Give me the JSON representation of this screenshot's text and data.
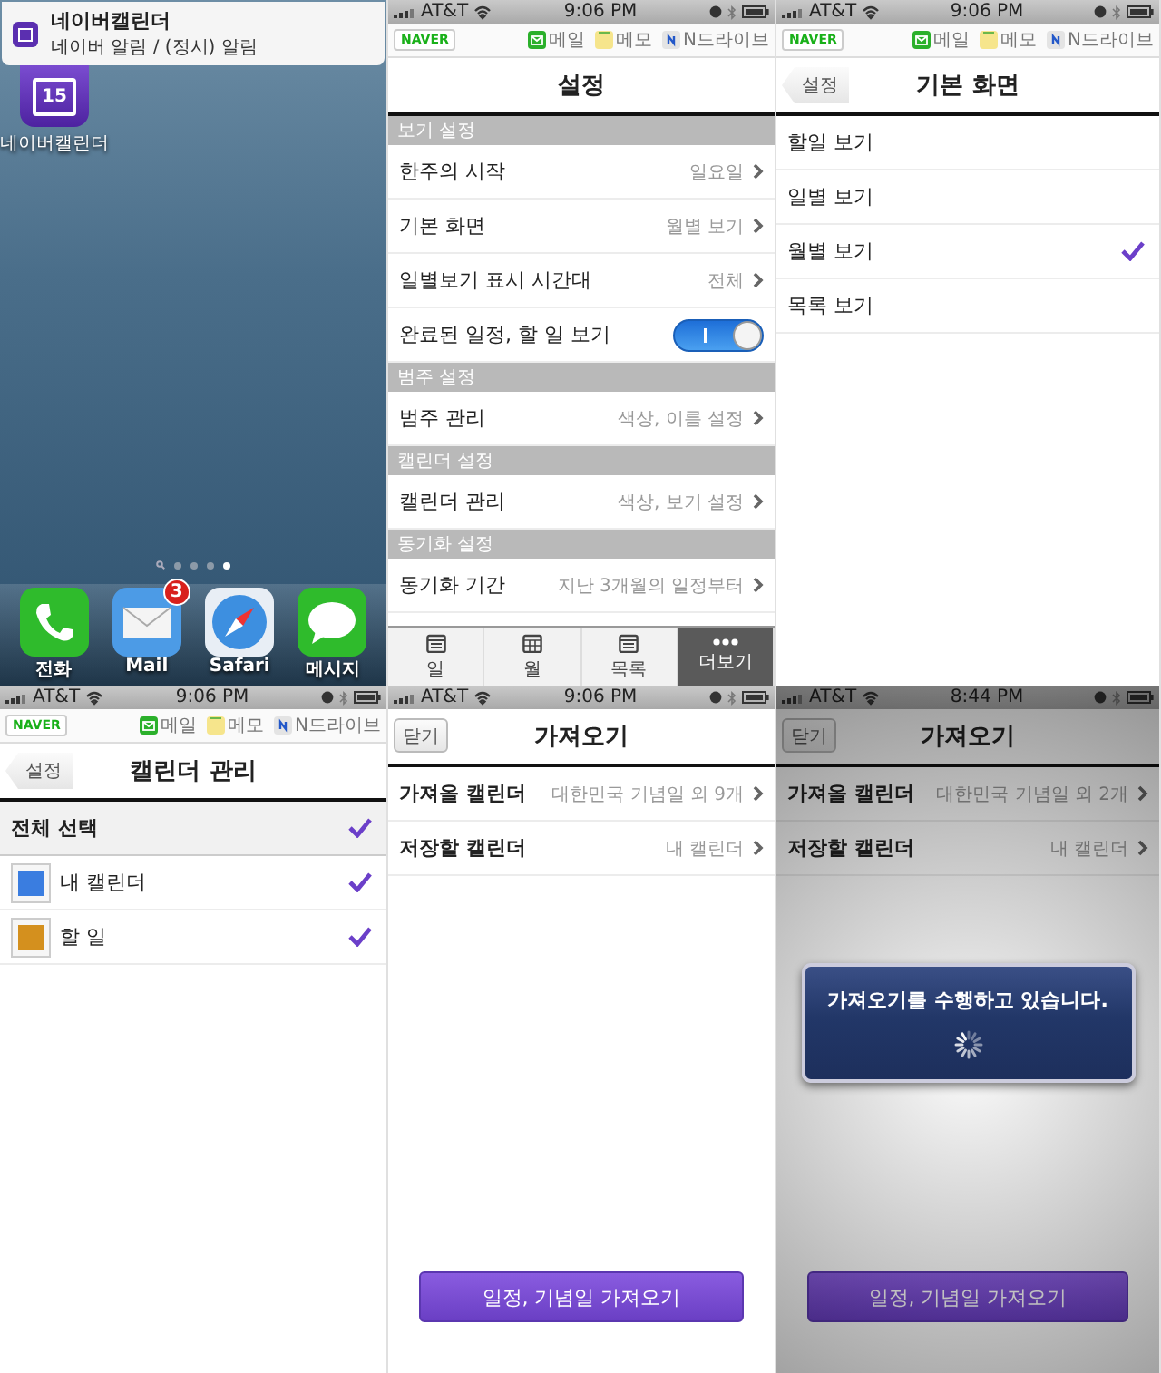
{
  "home_screen": {
    "notification": {
      "title": "네이버캘린더",
      "message": "네이버 알림 / (정시) 알림"
    },
    "app_icon": {
      "date": "15",
      "label": "네이버캘린더"
    },
    "page_dots": [
      {
        "selected": false
      },
      {
        "selected": false
      },
      {
        "selected": false
      },
      {
        "selected": true
      }
    ],
    "dock": [
      {
        "kind": "phone",
        "label": "전화"
      },
      {
        "kind": "mail",
        "label": "Mail",
        "badge": "3"
      },
      {
        "kind": "browser",
        "label": "Safari"
      },
      {
        "kind": "messages",
        "label": "메시지"
      }
    ]
  },
  "settings_screen": {
    "status_bar": {
      "carrier": "AT&T",
      "time": "9:06 PM"
    },
    "naver_bar": {
      "logo": "NAVER",
      "links": [
        {
          "kind": "mail",
          "label": "메일"
        },
        {
          "kind": "memo",
          "label": "메모"
        },
        {
          "kind": "drive",
          "label": "N드라이브"
        }
      ]
    },
    "title": "설정",
    "sections": [
      {
        "header": "보기 설정",
        "rows": [
          {
            "kind": "link",
            "label": "한주의 시작",
            "value": "일요일"
          },
          {
            "kind": "link",
            "label": "기본 화면",
            "value": "월별 보기"
          },
          {
            "kind": "link",
            "label": "일별보기 표시 시간대",
            "value": "전체"
          },
          {
            "kind": "toggle",
            "label": "완료된 일정, 할 일 보기",
            "on": true
          }
        ]
      },
      {
        "header": "범주 설정",
        "rows": [
          {
            "kind": "link",
            "label": "범주 관리",
            "value": "색상, 이름 설정"
          }
        ]
      },
      {
        "header": "캘린더 설정",
        "rows": [
          {
            "kind": "link",
            "label": "캘린더 관리",
            "value": "색상, 보기 설정"
          }
        ]
      },
      {
        "header": "동기화 설정",
        "rows": [
          {
            "kind": "link",
            "label": "동기화 기간",
            "value": "지난 3개월의 일정부터"
          }
        ]
      }
    ],
    "tab_bar": [
      {
        "kind": "day",
        "label": "일",
        "selected": false
      },
      {
        "kind": "month",
        "label": "월",
        "selected": false
      },
      {
        "kind": "list",
        "label": "목록",
        "selected": false
      },
      {
        "kind": "more",
        "label": "더보기",
        "selected": true
      }
    ]
  },
  "default_view_screen": {
    "status_bar": {
      "carrier": "AT&T",
      "time": "9:06 PM"
    },
    "naver_bar": {
      "logo": "NAVER",
      "links": [
        {
          "kind": "mail",
          "label": "메일"
        },
        {
          "kind": "memo",
          "label": "메모"
        },
        {
          "kind": "drive",
          "label": "N드라이브"
        }
      ]
    },
    "back_button": "설정",
    "title": "기본 화면",
    "options": [
      {
        "label": "할일 보기",
        "selected": false
      },
      {
        "label": "일별 보기",
        "selected": false
      },
      {
        "label": "월별 보기",
        "selected": true
      },
      {
        "label": "목록 보기",
        "selected": false
      }
    ]
  },
  "calendar_manage_screen": {
    "status_bar": {
      "carrier": "AT&T",
      "time": "9:06 PM"
    },
    "naver_bar": {
      "logo": "NAVER",
      "links": [
        {
          "kind": "mail",
          "label": "메일"
        },
        {
          "kind": "memo",
          "label": "메모"
        },
        {
          "kind": "drive",
          "label": "N드라이브"
        }
      ]
    },
    "back_button": "설정",
    "title": "캘린더 관리",
    "select_all": {
      "label": "전체 선택",
      "checked": true
    },
    "calendars": [
      {
        "name": "내 캘린더",
        "color": "#3a7de0",
        "checked": true
      },
      {
        "name": "할 일",
        "color": "#d4901e",
        "checked": true
      }
    ]
  },
  "import_screen": {
    "status_bar": {
      "carrier": "AT&T",
      "time": "9:06 PM"
    },
    "close_button": "닫기",
    "title": "가져오기",
    "rows": [
      {
        "label": "가져올 캘린더",
        "value": "대한민국 기념일 외 9개"
      },
      {
        "label": "저장할 캘린더",
        "value": "내 캘린더"
      }
    ],
    "action_button": "일정, 기념일 가져오기"
  },
  "import_progress_screen": {
    "status_bar": {
      "carrier": "AT&T",
      "time": "8:44 PM"
    },
    "close_button": "닫기",
    "title": "가져오기",
    "rows": [
      {
        "label": "가져올 캘린더",
        "value": "대한민국 기념일 외 2개"
      },
      {
        "label": "저장할 캘린더",
        "value": "내 캘린더"
      }
    ],
    "action_button": "일정, 기념일 가져오기",
    "dialog": {
      "message": "가져오기를 수행하고 있습니다."
    }
  }
}
